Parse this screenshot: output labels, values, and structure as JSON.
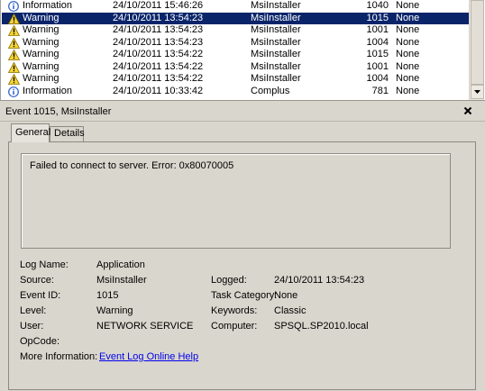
{
  "events": [
    {
      "level": "Information",
      "icon": "information-icon",
      "date": "24/10/2011 15:46:26",
      "source": "MsiInstaller",
      "event_id": "1040",
      "task": "None",
      "selected": false
    },
    {
      "level": "Warning",
      "icon": "warning-icon",
      "date": "24/10/2011 13:54:23",
      "source": "MsiInstaller",
      "event_id": "1015",
      "task": "None",
      "selected": true
    },
    {
      "level": "Warning",
      "icon": "warning-icon",
      "date": "24/10/2011 13:54:23",
      "source": "MsiInstaller",
      "event_id": "1001",
      "task": "None",
      "selected": false
    },
    {
      "level": "Warning",
      "icon": "warning-icon",
      "date": "24/10/2011 13:54:23",
      "source": "MsiInstaller",
      "event_id": "1004",
      "task": "None",
      "selected": false
    },
    {
      "level": "Warning",
      "icon": "warning-icon",
      "date": "24/10/2011 13:54:22",
      "source": "MsiInstaller",
      "event_id": "1015",
      "task": "None",
      "selected": false
    },
    {
      "level": "Warning",
      "icon": "warning-icon",
      "date": "24/10/2011 13:54:22",
      "source": "MsiInstaller",
      "event_id": "1001",
      "task": "None",
      "selected": false
    },
    {
      "level": "Warning",
      "icon": "warning-icon",
      "date": "24/10/2011 13:54:22",
      "source": "MsiInstaller",
      "event_id": "1004",
      "task": "None",
      "selected": false
    },
    {
      "level": "Information",
      "icon": "information-icon",
      "date": "24/10/2011 10:33:42",
      "source": "Complus",
      "event_id": "781",
      "task": "None",
      "selected": false
    }
  ],
  "details": {
    "title": "Event 1015, MsiInstaller",
    "tabs": {
      "general": "General",
      "details": "Details"
    },
    "message": "Failed to connect to server. Error: 0x80070005",
    "labels": {
      "log_name": "Log Name:",
      "source": "Source:",
      "event_id": "Event ID:",
      "level": "Level:",
      "user": "User:",
      "opcode": "OpCode:",
      "more_info": "More Information:",
      "logged": "Logged:",
      "task_category": "Task Category:",
      "keywords": "Keywords:",
      "computer": "Computer:"
    },
    "values": {
      "log_name": "Application",
      "source": "MsiInstaller",
      "event_id": "1015",
      "level": "Warning",
      "user": "NETWORK SERVICE",
      "opcode": "",
      "more_info_link": "Event Log Online Help",
      "logged": "24/10/2011 13:54:23",
      "task_category": "None",
      "keywords": "Classic",
      "computer": "SPSQL.SP2010.local"
    }
  },
  "colors": {
    "selection": "#0a246a",
    "pane_background": "#d9d6cd",
    "link": "#0000ee",
    "warning_yellow": "#f7d634",
    "information_blue": "#2a5ec9"
  }
}
